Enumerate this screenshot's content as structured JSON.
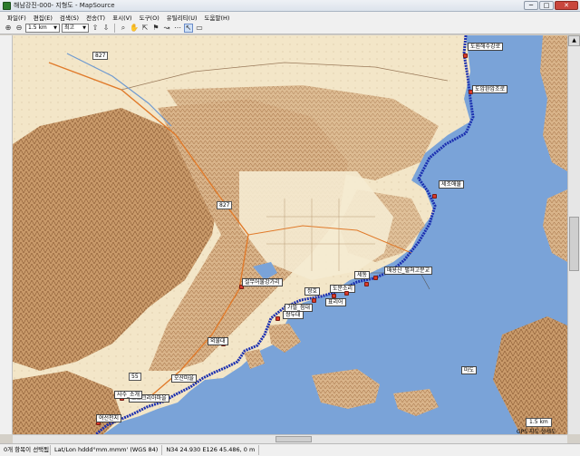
{
  "window": {
    "title": "해남강진-000- 지형도 - MapSource",
    "minimize": "─",
    "maximize": "□",
    "close": "✕"
  },
  "menu": [
    "파일(F)",
    "편집(E)",
    "검색(S)",
    "전송(T)",
    "표시(V)",
    "도구(O)",
    "유틸리티(U)",
    "도움말(H)"
  ],
  "toolbar": {
    "zoom_value": "1.5 km",
    "detail_value": "최고"
  },
  "map": {
    "road_badges": [
      "827",
      "827",
      "55"
    ],
    "waypoints": [
      "도원해수강로",
      "도암완암조로",
      "세조애물",
      "세동",
      "배용산_펼쳐고분교",
      "도문소리",
      "쌍호",
      "표리어",
      "가벌_점대",
      "설무어물강가리",
      "쌍두대",
      "외불대",
      "오산마을",
      "모노크리아마을",
      "사수_소개",
      "여선천지"
    ],
    "place_label": "마도",
    "scale": "1.5 km",
    "gps_note": "GPS 지도 상세도"
  },
  "status": {
    "selection": "0개 항목이 선택됨",
    "format": "Lat/Lon hddd°mm.mmm' (WGS 84)",
    "coords": "N34 24.930 E126 45.486, 0 m"
  },
  "colors": {
    "water": "#7aa3d8",
    "land_plain": "#f3e6c8",
    "relief": "#b07a4a",
    "track": "#1b2fb0",
    "waypoint": "#d93a2a"
  }
}
